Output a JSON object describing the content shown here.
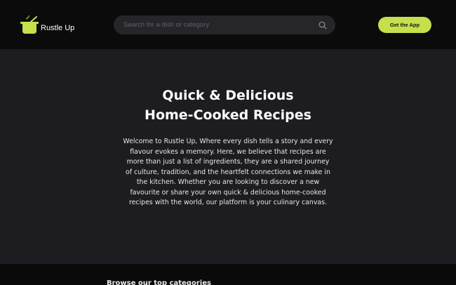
{
  "header": {
    "brand": "Rustle Up",
    "search_placeholder": "Search for a dish or category",
    "cta_label": "Get the App"
  },
  "hero": {
    "title_line1": "Quick & Delicious",
    "title_line2": "Home-Cooked Recipes",
    "body": "Welcome to Rustle Up, Where every dish tells a story and every flavour evokes a memory. Here, we believe that recipes are more than just a list of ingredients, they are a shared journey of culture, tradition, and the heartfelt connections we make in the kitchen. Whether you are looking to discover a new favourite or share your own quick & delicious home-cooked recipes with the world, our platform is your culinary canvas."
  },
  "categories": {
    "heading": "Browse our top categories"
  },
  "colors": {
    "accent": "#c4e04a",
    "header_bg": "#0b0b0c",
    "hero_bg": "#1c1c21",
    "search_bg": "#26262a"
  },
  "icons": {
    "logo": "cooking-pot-icon",
    "search": "search-icon"
  }
}
